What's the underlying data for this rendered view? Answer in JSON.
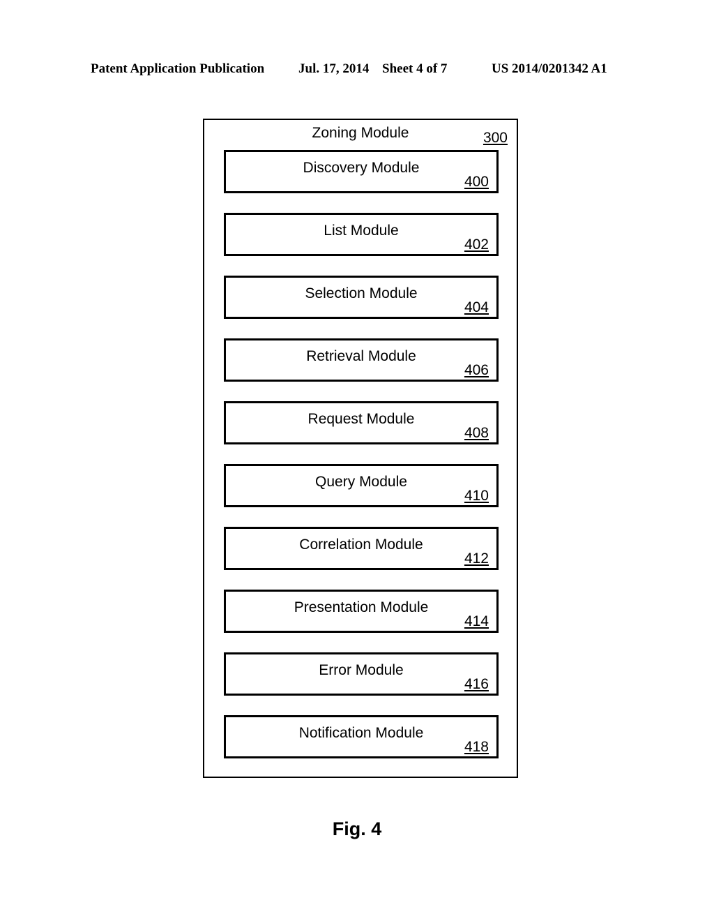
{
  "header": {
    "publication": "Patent Application Publication",
    "date": "Jul. 17, 2014",
    "sheet": "Sheet 4 of 7",
    "document_number": "US 2014/0201342 A1"
  },
  "figure": {
    "caption": "Fig. 4",
    "outer_module": {
      "label": "Zoning Module",
      "reference": "300"
    },
    "modules": [
      {
        "label": "Discovery Module",
        "reference": "400"
      },
      {
        "label": "List Module",
        "reference": "402"
      },
      {
        "label": "Selection Module",
        "reference": "404"
      },
      {
        "label": "Retrieval Module",
        "reference": "406"
      },
      {
        "label": "Request Module",
        "reference": "408"
      },
      {
        "label": "Query Module",
        "reference": "410"
      },
      {
        "label": "Correlation Module",
        "reference": "412"
      },
      {
        "label": "Presentation Module",
        "reference": "414"
      },
      {
        "label": "Error Module",
        "reference": "416"
      },
      {
        "label": "Notification Module",
        "reference": "418"
      }
    ]
  },
  "colors": {
    "page_background": "#ffffff",
    "ink": "#000000"
  }
}
